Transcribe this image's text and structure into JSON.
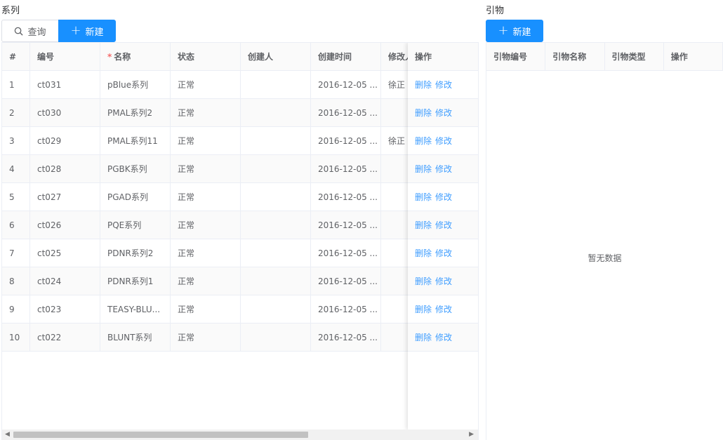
{
  "series": {
    "title": "系列",
    "query_label": "查询",
    "new_label": "新建",
    "columns": {
      "idx": "#",
      "code": "编号",
      "name": "名称",
      "status": "状态",
      "creator": "创建人",
      "created_time": "创建时间",
      "modifier": "修改人",
      "actions": "操作"
    },
    "rows": [
      {
        "idx": "1",
        "code": "ct031",
        "name": "pBlue系列",
        "status": "正常",
        "creator": "",
        "created_time": "2016-12-05 ...",
        "modifier": "徐正",
        "delete": "删除",
        "edit": "修改"
      },
      {
        "idx": "2",
        "code": "ct030",
        "name": "PMAL系列2",
        "status": "正常",
        "creator": "",
        "created_time": "2016-12-05 ...",
        "modifier": "",
        "delete": "删除",
        "edit": "修改"
      },
      {
        "idx": "3",
        "code": "ct029",
        "name": "PMAL系列11",
        "status": "正常",
        "creator": "",
        "created_time": "2016-12-05 ...",
        "modifier": "徐正",
        "delete": "删除",
        "edit": "修改"
      },
      {
        "idx": "4",
        "code": "ct028",
        "name": "PGBK系列",
        "status": "正常",
        "creator": "",
        "created_time": "2016-12-05 ...",
        "modifier": "",
        "delete": "删除",
        "edit": "修改"
      },
      {
        "idx": "5",
        "code": "ct027",
        "name": "PGAD系列",
        "status": "正常",
        "creator": "",
        "created_time": "2016-12-05 ...",
        "modifier": "",
        "delete": "删除",
        "edit": "修改"
      },
      {
        "idx": "6",
        "code": "ct026",
        "name": "PQE系列",
        "status": "正常",
        "creator": "",
        "created_time": "2016-12-05 ...",
        "modifier": "",
        "delete": "删除",
        "edit": "修改"
      },
      {
        "idx": "7",
        "code": "ct025",
        "name": "PDNR系列2",
        "status": "正常",
        "creator": "",
        "created_time": "2016-12-05 ...",
        "modifier": "",
        "delete": "删除",
        "edit": "修改"
      },
      {
        "idx": "8",
        "code": "ct024",
        "name": "PDNR系列1",
        "status": "正常",
        "creator": "",
        "created_time": "2016-12-05 ...",
        "modifier": "",
        "delete": "删除",
        "edit": "修改"
      },
      {
        "idx": "9",
        "code": "ct023",
        "name": "TEASY-BLU...",
        "status": "正常",
        "creator": "",
        "created_time": "2016-12-05 ...",
        "modifier": "",
        "delete": "删除",
        "edit": "修改"
      },
      {
        "idx": "10",
        "code": "ct022",
        "name": "BLUNT系列",
        "status": "正常",
        "creator": "",
        "created_time": "2016-12-05 ...",
        "modifier": "",
        "delete": "删除",
        "edit": "修改"
      }
    ]
  },
  "primer": {
    "title": "引物",
    "new_label": "新建",
    "columns": [
      "引物编号",
      "引物名称",
      "引物类型",
      "操作"
    ],
    "empty_text": "暂无数据"
  },
  "icons": {
    "query": "search-icon",
    "new": "plus-icon"
  },
  "colors": {
    "primary": "#1890ff",
    "link": "#409eff",
    "required": "#f56c6c"
  }
}
